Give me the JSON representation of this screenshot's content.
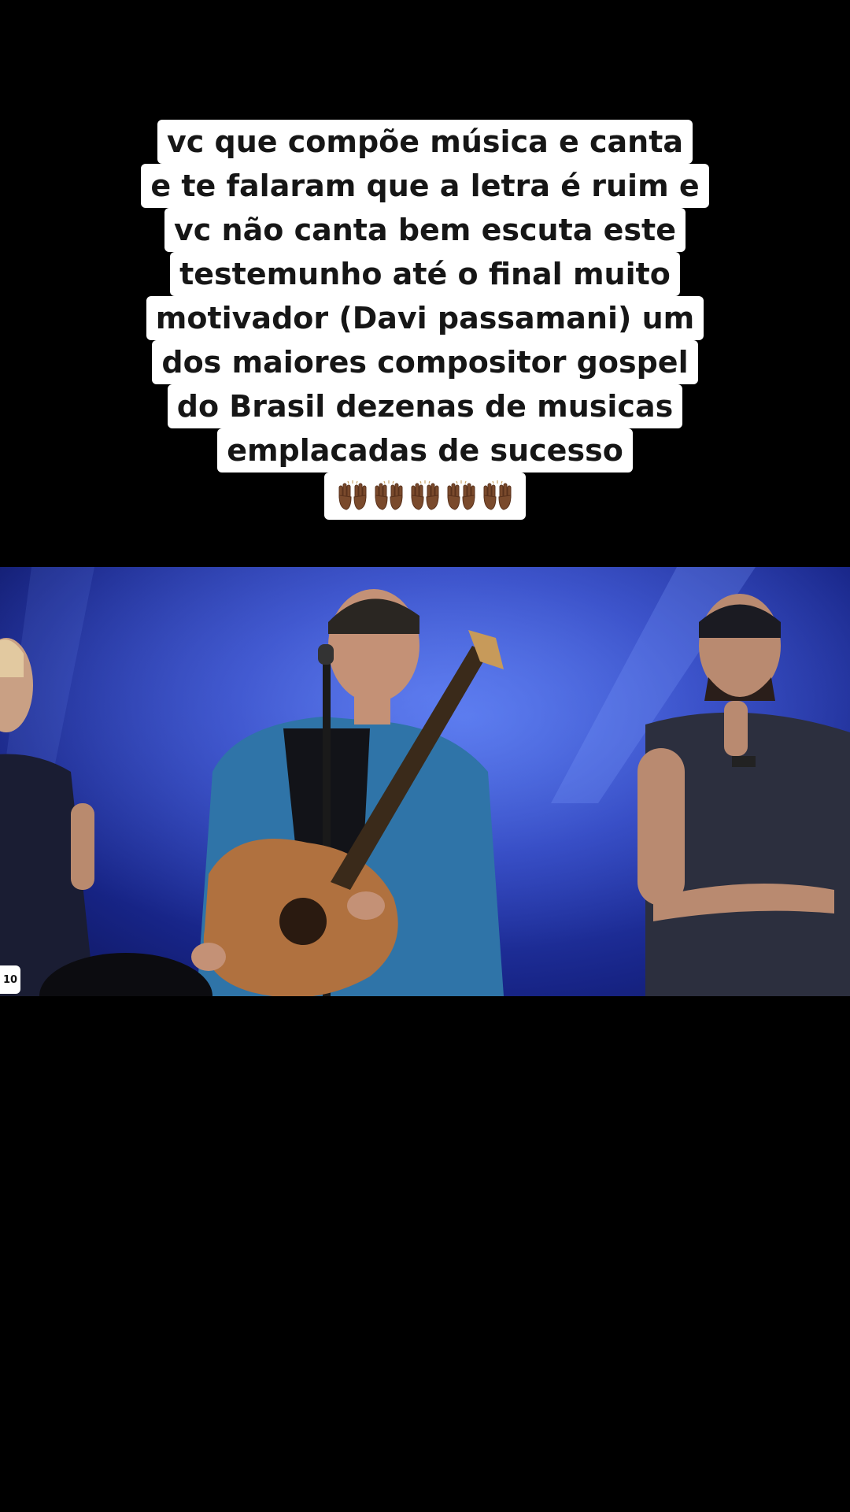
{
  "caption": {
    "lines": [
      "vc que compõe música e canta",
      "e te falaram que a letra é ruim e",
      "vc não canta bem escuta este",
      "testemunho até o final muito",
      "motivador (Davi passamani) um",
      "dos maiores compositor gospel",
      "do Brasil dezenas de musicas",
      "emplacadas de sucesso"
    ],
    "emoji_icons": [
      "raising-hands-icon",
      "raising-hands-icon",
      "raising-hands-icon",
      "raising-hands-icon",
      "raising-hands-icon"
    ]
  },
  "video": {
    "watermark_text": "10"
  },
  "colors": {
    "background": "#000000",
    "caption_bg": "#ffffff",
    "caption_text": "#161616",
    "stage_blue": "#2a3fb8"
  }
}
